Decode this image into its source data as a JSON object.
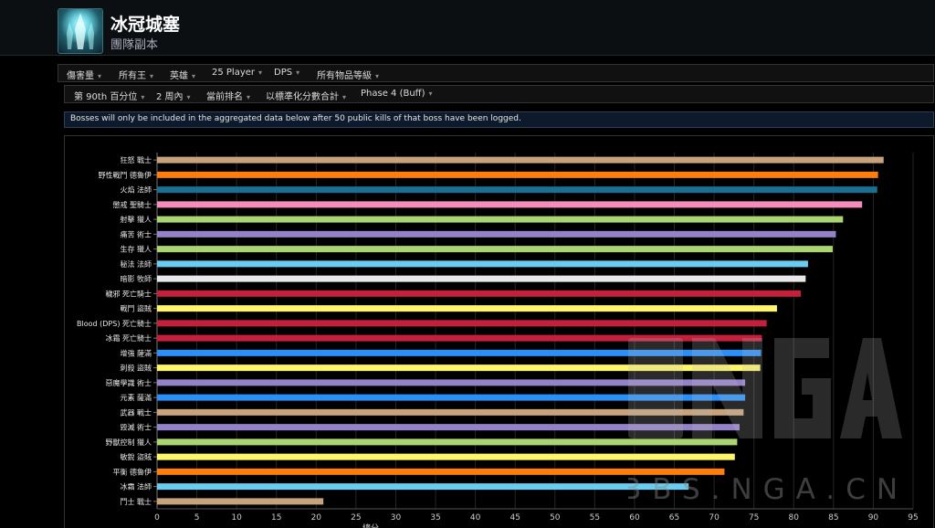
{
  "header": {
    "title": "冰冠城塞",
    "subtitle": "團隊副本"
  },
  "filters_row1": [
    {
      "label": "傷害量"
    },
    {
      "label": "所有王"
    },
    {
      "label": "英雄"
    },
    {
      "label": "25 Player"
    },
    {
      "label": "DPS"
    },
    {
      "label": "所有物品等級"
    }
  ],
  "filters_row2": [
    {
      "label": "第 90th 百分位"
    },
    {
      "label": "2 周內"
    },
    {
      "label": "當前排名"
    },
    {
      "label": "以標準化分數合計"
    },
    {
      "label": "Phase 4 (Buff)"
    }
  ],
  "notice": "Bosses will only be included in the aggregated data below after 50 public kills of that boss have been logged.",
  "watermark": {
    "text": "BBS.NGA.CN"
  },
  "chart_data": {
    "type": "bar",
    "orientation": "horizontal",
    "title": "",
    "xlabel": "總分",
    "ylabel": "",
    "xlim": [
      0,
      95
    ],
    "xticks": [
      0,
      5,
      10,
      15,
      20,
      25,
      30,
      35,
      40,
      45,
      50,
      55,
      60,
      65,
      70,
      75,
      80,
      85,
      90,
      95
    ],
    "grid": true,
    "categories": [
      "狂怒 戰士",
      "野性戰鬥 德魯伊",
      "火焰 法師",
      "懲戒 聖騎士",
      "射擊 獵人",
      "痛苦 術士",
      "生存 獵人",
      "秘法 法師",
      "暗影 牧師",
      "穢邪 死亡騎士",
      "戰鬥 盜賊",
      "Blood (DPS) 死亡騎士",
      "冰霜 死亡騎士",
      "增強 薩滿",
      "刺殺 盜賊",
      "惡魔學識 術士",
      "元素 薩滿",
      "武器 戰士",
      "毀滅 術士",
      "野獸控制 獵人",
      "敏銳 盜賊",
      "平衡 德魯伊",
      "冰霜 法師",
      "鬥士 戰士"
    ],
    "values": [
      91.3,
      90.6,
      90.5,
      88.6,
      86.2,
      85.3,
      84.9,
      81.8,
      81.5,
      80.9,
      77.9,
      76.6,
      76.0,
      75.9,
      75.8,
      73.9,
      73.9,
      73.7,
      73.2,
      72.9,
      72.6,
      71.3,
      66.8,
      20.9
    ],
    "colors": [
      "#c7a27a",
      "#ff7d0a",
      "#1a6f94",
      "#f58cba",
      "#abd473",
      "#9482c9",
      "#abd473",
      "#69ccf0",
      "#e8e8e8",
      "#c41f3b",
      "#fff569",
      "#c41f3b",
      "#c41f3b",
      "#2a8ff7",
      "#fff569",
      "#9482c9",
      "#2a8ff7",
      "#c7a27a",
      "#9482c9",
      "#abd473",
      "#fff569",
      "#ff7d0a",
      "#69ccf0",
      "#c7a27a"
    ]
  }
}
